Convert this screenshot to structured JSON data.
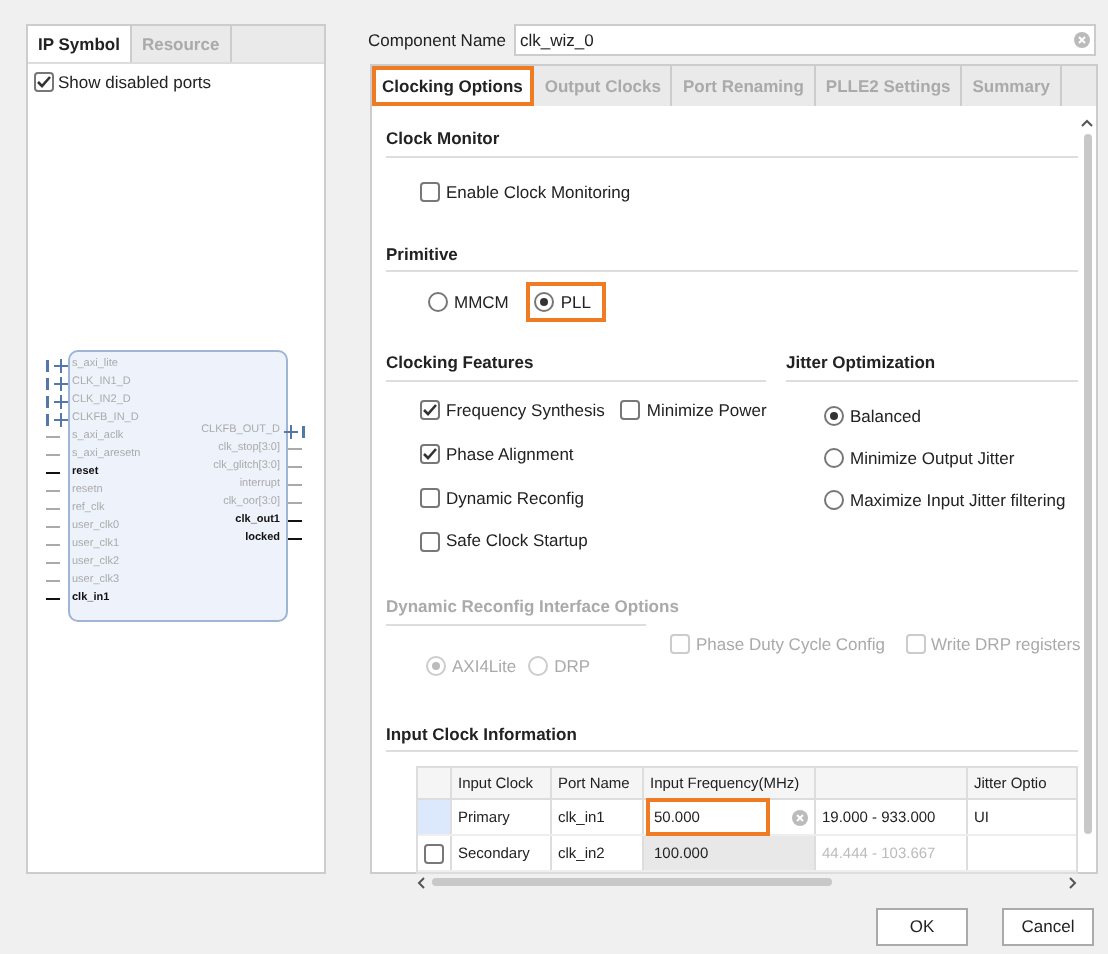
{
  "left_panel": {
    "tabs": [
      {
        "label": "IP Symbol",
        "selected": true
      },
      {
        "label": "Resource",
        "selected": false
      }
    ],
    "show_disabled_ports": {
      "label": "Show disabled ports",
      "checked": true
    },
    "symbol": {
      "left_ports": [
        {
          "name": "s_axi_lite",
          "kind": "bus",
          "active": false
        },
        {
          "name": "CLK_IN1_D",
          "kind": "bus",
          "active": false
        },
        {
          "name": "CLK_IN2_D",
          "kind": "bus",
          "active": false
        },
        {
          "name": "CLKFB_IN_D",
          "kind": "bus",
          "active": false
        },
        {
          "name": "s_axi_aclk",
          "kind": "wire",
          "active": false
        },
        {
          "name": "s_axi_aresetn",
          "kind": "wire",
          "active": false
        },
        {
          "name": "reset",
          "kind": "wire",
          "active": true
        },
        {
          "name": "resetn",
          "kind": "wire",
          "active": false
        },
        {
          "name": "ref_clk",
          "kind": "wire",
          "active": false
        },
        {
          "name": "user_clk0",
          "kind": "wire",
          "active": false
        },
        {
          "name": "user_clk1",
          "kind": "wire",
          "active": false
        },
        {
          "name": "user_clk2",
          "kind": "wire",
          "active": false
        },
        {
          "name": "user_clk3",
          "kind": "wire",
          "active": false
        },
        {
          "name": "clk_in1",
          "kind": "wire",
          "active": true
        }
      ],
      "right_ports": [
        {
          "name": "CLKFB_OUT_D",
          "kind": "bus",
          "active": false
        },
        {
          "name": "clk_stop[3:0]",
          "kind": "wire",
          "active": false
        },
        {
          "name": "clk_glitch[3:0]",
          "kind": "wire",
          "active": false
        },
        {
          "name": "interrupt",
          "kind": "wire",
          "active": false
        },
        {
          "name": "clk_oor[3:0]",
          "kind": "wire",
          "active": false
        },
        {
          "name": "clk_out1",
          "kind": "wire",
          "active": true
        },
        {
          "name": "locked",
          "kind": "wire",
          "active": true
        }
      ]
    }
  },
  "component_name": {
    "label": "Component Name",
    "value": "clk_wiz_0"
  },
  "tabs": [
    {
      "label": "Clocking Options",
      "selected": true,
      "highlighted": true
    },
    {
      "label": "Output Clocks",
      "selected": false,
      "highlighted": false
    },
    {
      "label": "Port Renaming",
      "selected": false,
      "highlighted": false
    },
    {
      "label": "PLLE2 Settings",
      "selected": false,
      "highlighted": false
    },
    {
      "label": "Summary",
      "selected": false,
      "highlighted": false
    }
  ],
  "clock_monitor": {
    "title": "Clock Monitor",
    "option": {
      "label": "Enable Clock Monitoring",
      "checked": false
    }
  },
  "primitive": {
    "title": "Primitive",
    "options": [
      {
        "label": "MMCM",
        "selected": false,
        "highlighted": false
      },
      {
        "label": "PLL",
        "selected": true,
        "highlighted": true
      }
    ]
  },
  "clocking_features": {
    "title": "Clocking Features",
    "rows": [
      [
        {
          "label": "Frequency Synthesis",
          "checked": true
        },
        {
          "label": "Minimize Power",
          "checked": false
        }
      ],
      [
        {
          "label": "Phase Alignment",
          "checked": true
        }
      ],
      [
        {
          "label": "Dynamic Reconfig",
          "checked": false
        }
      ],
      [
        {
          "label": "Safe Clock Startup",
          "checked": false
        }
      ]
    ]
  },
  "jitter_optimization": {
    "title": "Jitter Optimization",
    "options": [
      {
        "label": "Balanced",
        "selected": true
      },
      {
        "label": "Minimize Output Jitter",
        "selected": false
      },
      {
        "label": "Maximize Input Jitter filtering",
        "selected": false
      }
    ]
  },
  "dynamic_reconfig_interface": {
    "title": "Dynamic Reconfig Interface Options",
    "disabled": true,
    "checkboxes": [
      {
        "label": "Phase Duty Cycle Config",
        "checked": false
      },
      {
        "label": "Write DRP registers",
        "checked": false
      }
    ],
    "radios": [
      {
        "label": "AXI4Lite",
        "selected": true
      },
      {
        "label": "DRP",
        "selected": false
      }
    ]
  },
  "input_clock_information": {
    "title": "Input Clock Information",
    "columns": [
      {
        "label": "Input Clock"
      },
      {
        "label": "Port Name"
      },
      {
        "label": "Input Frequency(MHz)"
      },
      {},
      {
        "label": "Jitter Optio"
      }
    ],
    "rows": [
      {
        "kind": "primary",
        "input_clock": "Primary",
        "port_name": "clk_in1",
        "input_frequency": "50.000",
        "frequency_highlighted": true,
        "range": "19.000 - 933.000",
        "jitter_options": "UI",
        "disabled": false
      },
      {
        "kind": "optional",
        "checked": false,
        "input_clock": "Secondary",
        "port_name": "clk_in2",
        "input_frequency": "100.000",
        "frequency_highlighted": false,
        "range": "44.444 - 103.667",
        "disabled": true
      }
    ]
  },
  "buttons": [
    {
      "label": "OK"
    },
    {
      "label": "Cancel"
    }
  ]
}
